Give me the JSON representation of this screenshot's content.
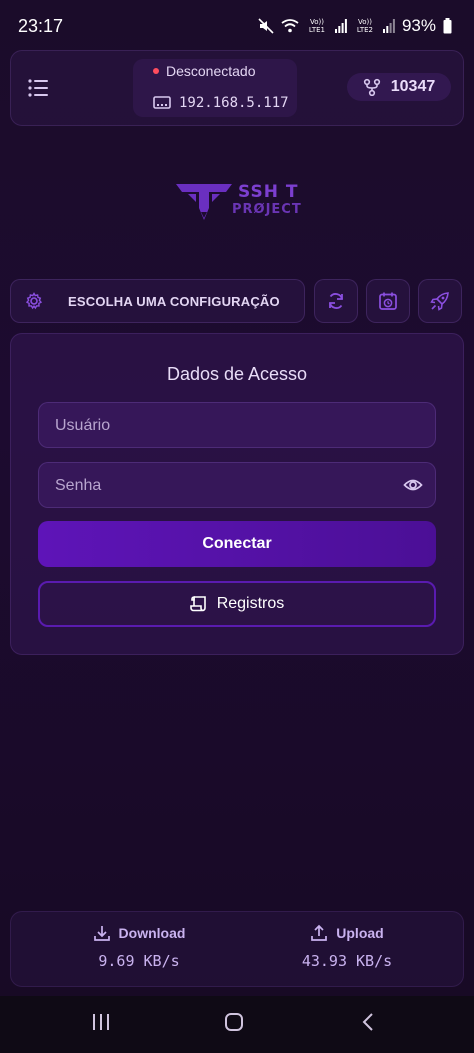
{
  "status_bar": {
    "time": "23:17",
    "sim1_label": "Vo)) LTE1",
    "sim2_label": "Vo)) LTE2",
    "battery": "93%"
  },
  "header": {
    "connection_status": "Desconectado",
    "ip_address": "192.168.5.117",
    "counter": "10347",
    "status_color": "#ff4d5e"
  },
  "logo": {
    "line1": "SSH T",
    "line2": "PRØJECT"
  },
  "config": {
    "label": "ESCOLHA UMA CONFIGURAÇÃO"
  },
  "form": {
    "title": "Dados de Acesso",
    "username_placeholder": "Usuário",
    "password_placeholder": "Senha",
    "connect_label": "Conectar",
    "logs_label": "Registros"
  },
  "stats": {
    "download_label": "Download",
    "download_value": "9.69 KB/s",
    "upload_label": "Upload",
    "upload_value": "43.93 KB/s"
  },
  "colors": {
    "accent": "#5e14b8",
    "background": "#1d0b30",
    "icon": "#8b4fe0"
  },
  "icons": [
    "list-icon",
    "ethernet-icon",
    "fork-icon",
    "gear-icon",
    "refresh-icon",
    "calendar-clock-icon",
    "rocket-icon",
    "eye-icon",
    "scroll-icon",
    "download-icon",
    "upload-icon"
  ]
}
